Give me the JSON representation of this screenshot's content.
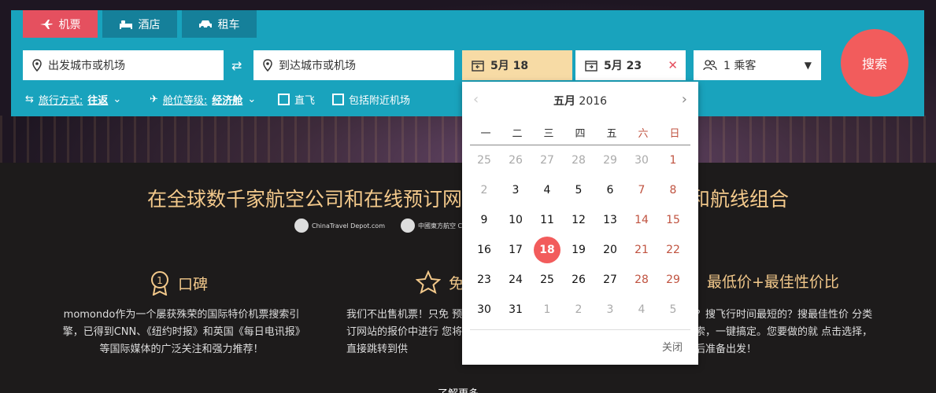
{
  "tabs": [
    {
      "label": "机票",
      "icon": "plane-icon",
      "active": true
    },
    {
      "label": "酒店",
      "icon": "bed-icon",
      "active": false
    },
    {
      "label": "租车",
      "icon": "car-icon",
      "active": false
    }
  ],
  "search": {
    "from_placeholder": "出发城市或机场",
    "to_placeholder": "到达城市或机场",
    "depart_date": "5月 18",
    "return_date": "5月 23",
    "passengers": "1 乘客",
    "button": "搜索"
  },
  "options": {
    "trip_label": "旅行方式:",
    "trip_value": "往返",
    "cabin_label": "舱位等级:",
    "cabin_value": "经济舱",
    "direct_label": "直飞",
    "nearby_label": "包括附近机场"
  },
  "calendar": {
    "month": "五月",
    "year": "2016",
    "weekdays": [
      "一",
      "二",
      "三",
      "四",
      "五",
      "六",
      "日"
    ],
    "days": [
      [
        "25",
        "26",
        "27",
        "28",
        "29",
        "30",
        "1"
      ],
      [
        "2",
        "3",
        "4",
        "5",
        "6",
        "7",
        "8"
      ],
      [
        "9",
        "10",
        "11",
        "12",
        "13",
        "14",
        "15"
      ],
      [
        "16",
        "17",
        "18",
        "19",
        "20",
        "21",
        "22"
      ],
      [
        "23",
        "24",
        "25",
        "26",
        "27",
        "28",
        "29"
      ],
      [
        "30",
        "31",
        "1",
        "2",
        "3",
        "4",
        "5"
      ]
    ],
    "selected": "18",
    "close": "关闭"
  },
  "main": {
    "headline": "在全球数千家航空公司和在线预订网站",
    "headline_tail": "票和航线组合",
    "logos": [
      "ChinaTravel Depot.com",
      "中國東方航空 CHINA EASTERN"
    ],
    "features": [
      {
        "title": "口碑",
        "icon": "medal-icon",
        "desc": "momondo作为一个屡获殊荣的国际特价机票搜索引擎，已得到CNN、《纽约时报》和英国《每日电讯报》等国际媒体的广泛关注和强力推荐！"
      },
      {
        "title": "免",
        "icon": "star-icon",
        "desc": "我们不出售机票！只免 预订网站的报价中进行 您将直接跳转到供"
      },
      {
        "title": "最低价+最佳性价比",
        "icon": "",
        "desc": "的？搜飞行时间最短的？搜最佳性价 分类搜索，一键搞定。您要做的就 点击选择，然后准备出发！"
      }
    ],
    "more": "了解更多"
  }
}
